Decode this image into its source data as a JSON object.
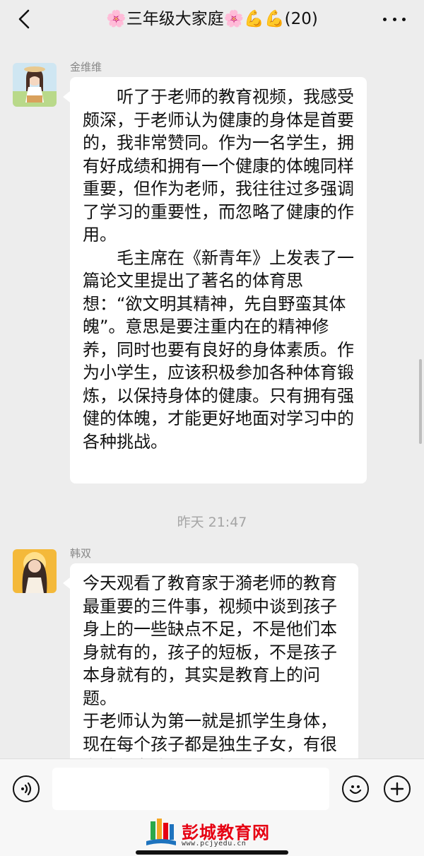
{
  "header": {
    "title": "🌸三年级大家庭🌸💪💪(20)"
  },
  "messages": [
    {
      "sender": "金维维",
      "paragraphs": [
        "听了于老师的教育视频，我感受颇深，于老师认为健康的身体是首要的，我非常赞同。作为一名学生，拥有好成绩和拥有一个健康的体魄同样重要，但作为老师，我往往过多强调了学习的重要性，而忽略了健康的作用。",
        "毛主席在《新青年》上发表了一篇论文里提出了著名的体育思想：“欲文明其精神，先自野蛮其体魄”。意思是要注重内在的精神修养，同时也要有良好的身体素质。作为小学生，应该积极参加各种体育锻炼，以保持身体的健康。只有拥有强健的体魄，才能更好地面对学习中的各种挑战。"
      ]
    },
    {
      "sender": "韩双",
      "paragraphs": [
        "今天观看了教育家于漪老师的教育最重要的三件事，视频中谈到孩子身上的一些缺点不足，不是他们本身就有的，孩子的短板，不是孩子本身就有的，其实是教育上的问题。",
        "于老师认为第一就是抓学生身体，现在每个孩子都是独生子女，有很多孩子身体都很不好。"
      ]
    }
  ],
  "timestamp": "昨天 21:47",
  "input": {
    "value": ""
  },
  "watermark": {
    "title": "彭城教育网",
    "url": "www.pcjyedu.cn"
  },
  "colors": {
    "background": "#ededed",
    "bubble": "#ffffff",
    "watermark_red": "#e60012"
  }
}
